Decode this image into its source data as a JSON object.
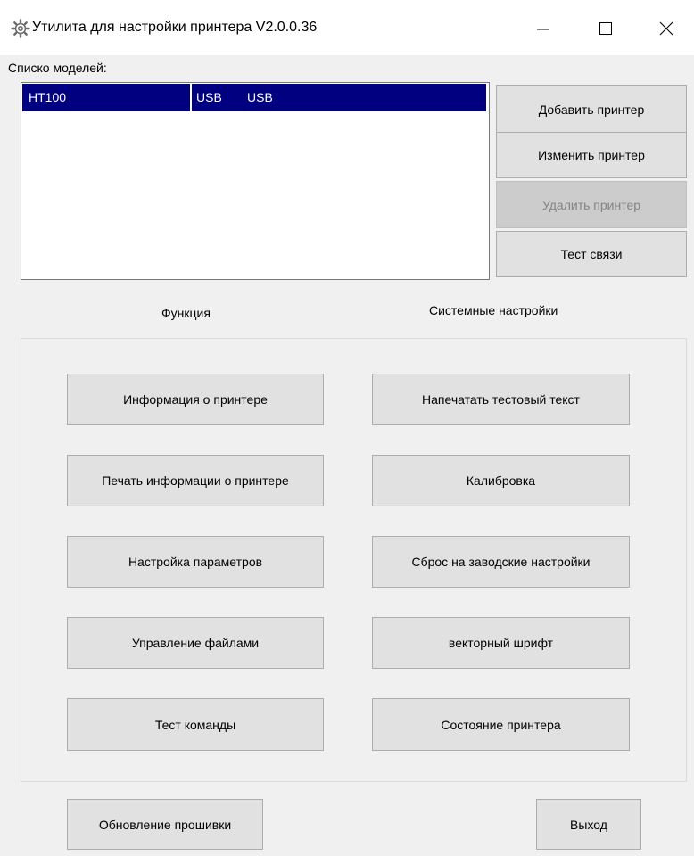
{
  "window": {
    "title": "Утилита для настройки принтера  V2.0.0.36",
    "minimize_glyph": "—",
    "maximize_glyph": "☐",
    "close_glyph": "✕"
  },
  "models": {
    "label": "Списко моделей:",
    "rows": [
      {
        "name": "HT100",
        "port": "USB",
        "connection": "USB"
      }
    ],
    "scroll_left": "<",
    "scroll_right": ">"
  },
  "printer_buttons": {
    "add": "Добавить принтер",
    "edit": "Изменить принтер",
    "delete": "Удалить принтер",
    "test_connection": "Тест связи"
  },
  "sections": {
    "function": "Функция",
    "system_settings": "Системные настройки"
  },
  "functions": {
    "printer_info": "Информация о принтере",
    "print_test_text": "Напечатать тестовый текст",
    "print_printer_info": "Печать информации о принтере",
    "calibration": "Калибровка",
    "parameter_settings": "Настройка параметров",
    "factory_reset": "Сброс на заводские настройки",
    "file_management": "Управление файлами",
    "vector_font": "векторный шрифт",
    "command_test": "Тест команды",
    "printer_status": "Состояние принтера"
  },
  "footer": {
    "firmware_update": "Обновление прошивки",
    "exit": "Выход"
  },
  "colors": {
    "selection": "#000080",
    "window_bg": "#f0f0f0",
    "button_bg": "#e1e1e1"
  }
}
